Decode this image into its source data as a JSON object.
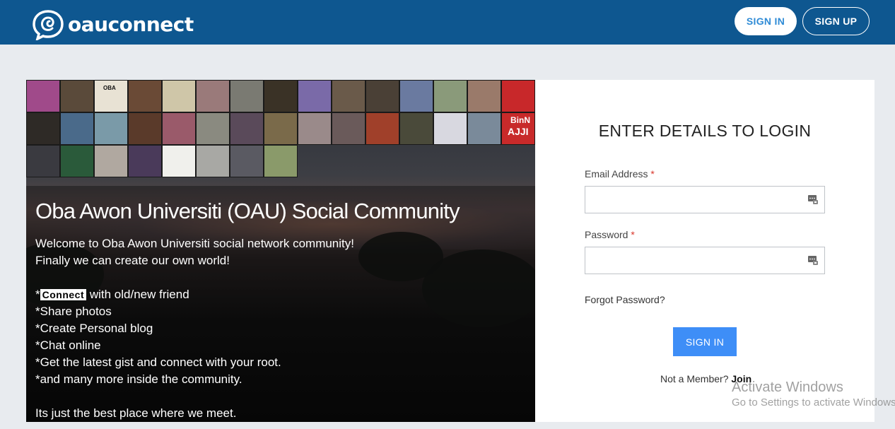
{
  "header": {
    "brand": "oauconnect",
    "sign_in": "SIGN IN",
    "sign_up": "SIGN UP",
    "background_color": "#0e5790"
  },
  "banner": {
    "title": "Oba Awon Universiti (OAU) Social Community",
    "welcome_line1": "Welcome to Oba Awon Universiti social network community!",
    "welcome_line2": "Finally we can create our own world!",
    "connect_prefix": "*",
    "connect_highlight": "Connect",
    "connect_suffix": " with old/new friend",
    "bullets": [
      "*Share photos",
      "*Create Personal blog",
      "*Chat online",
      "*Get the latest gist and connect with your root.",
      "*and many more inside the community."
    ],
    "closing": "Its just the best place where we meet.",
    "tile_badge_1": "OBA",
    "tile_badge_2": "BinN",
    "tile_badge_3": "AJJI"
  },
  "login": {
    "title": "ENTER DETAILS TO LOGIN",
    "email_label": "Email Address",
    "password_label": "Password",
    "required_mark": "*",
    "email_value": "",
    "password_value": "",
    "forgot": "Forgot Password?",
    "submit": "SIGN IN",
    "not_member": "Not a Member?",
    "join": "Join",
    "accent_color": "#3e8ef7"
  },
  "watermark": {
    "line1": "Activate Windows",
    "line2": "Go to Settings to activate Windows."
  }
}
